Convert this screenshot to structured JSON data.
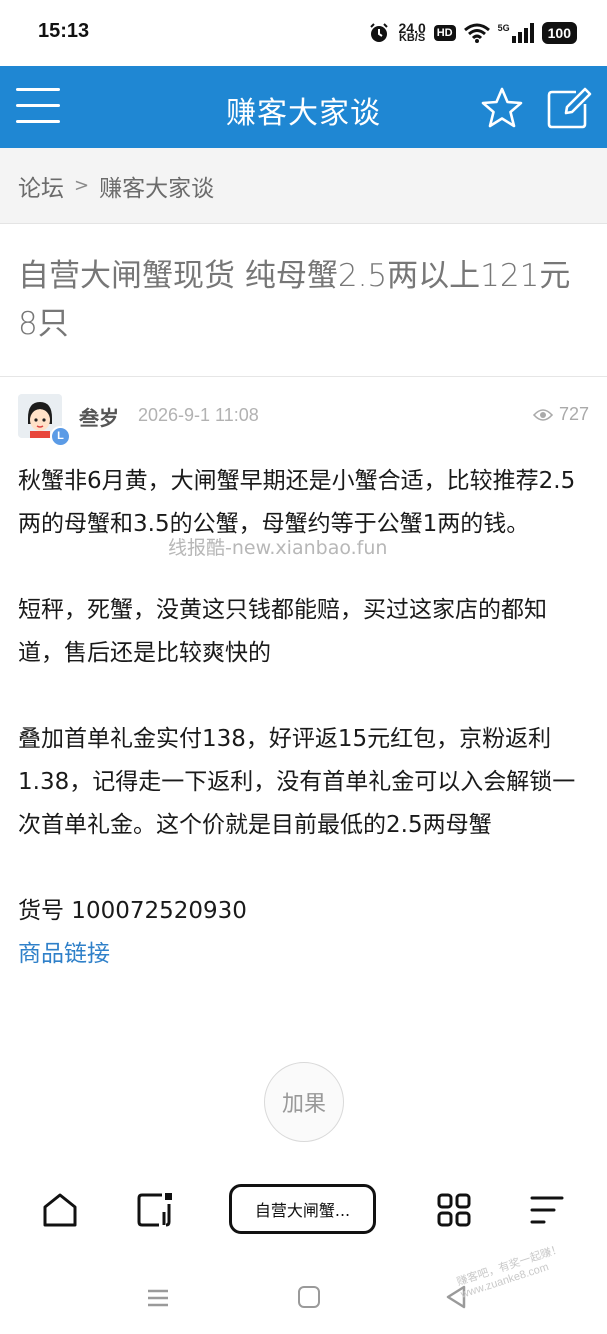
{
  "status_bar": {
    "time": "15:13",
    "net_speed": "24.0",
    "net_unit": "KB/S",
    "hd": "HD",
    "signal": "5G",
    "battery": "100"
  },
  "app_bar": {
    "title": "赚客大家谈",
    "menu_icon": "hamburger-menu-icon",
    "favorite_icon": "star-icon",
    "compose_icon": "edit-icon"
  },
  "breadcrumb": {
    "root": "论坛",
    "separator": ">",
    "current": "赚客大家谈"
  },
  "post": {
    "title": "自营大闸蟹现货 纯母蟹2.5两以上121元 8只",
    "author": "叁岁",
    "level": "L",
    "date": "2026-9-1 11:08",
    "views": "727",
    "paragraphs": [
      "秋蟹非6月黄，大闸蟹早期还是小蟹合适，比较推荐2.5两的母蟹和3.5的公蟹，母蟹约等于公蟹1两的钱。",
      "短秤，死蟹，没黄这只钱都能赔，买过这家店的都知道，售后还是比较爽快的",
      "叠加首单礼金实付138，好评返15元红包，京粉返利1.38，记得走一下返利，没有首单礼金可以入会解锁一次首单礼金。这个价就是目前最低的2.5两母蟹"
    ],
    "sku_line": "货号 100072520930",
    "product_link": "商品链接",
    "watermark": "线报酷-new.xianbao.fun"
  },
  "actions": {
    "plus_fruit": "加果"
  },
  "bottom_nav": {
    "current_tab_label": "自营大闸蟹...",
    "icons": [
      "home-icon",
      "window-icon",
      "grid-icon",
      "menu-lines-icon"
    ]
  },
  "corner_watermark": "赚客吧，有奖一起赚！ www.zuanke8.com",
  "colors": {
    "app_bar": "#1f87d3",
    "link": "#2f80c9",
    "badge": "#5b9be6"
  }
}
